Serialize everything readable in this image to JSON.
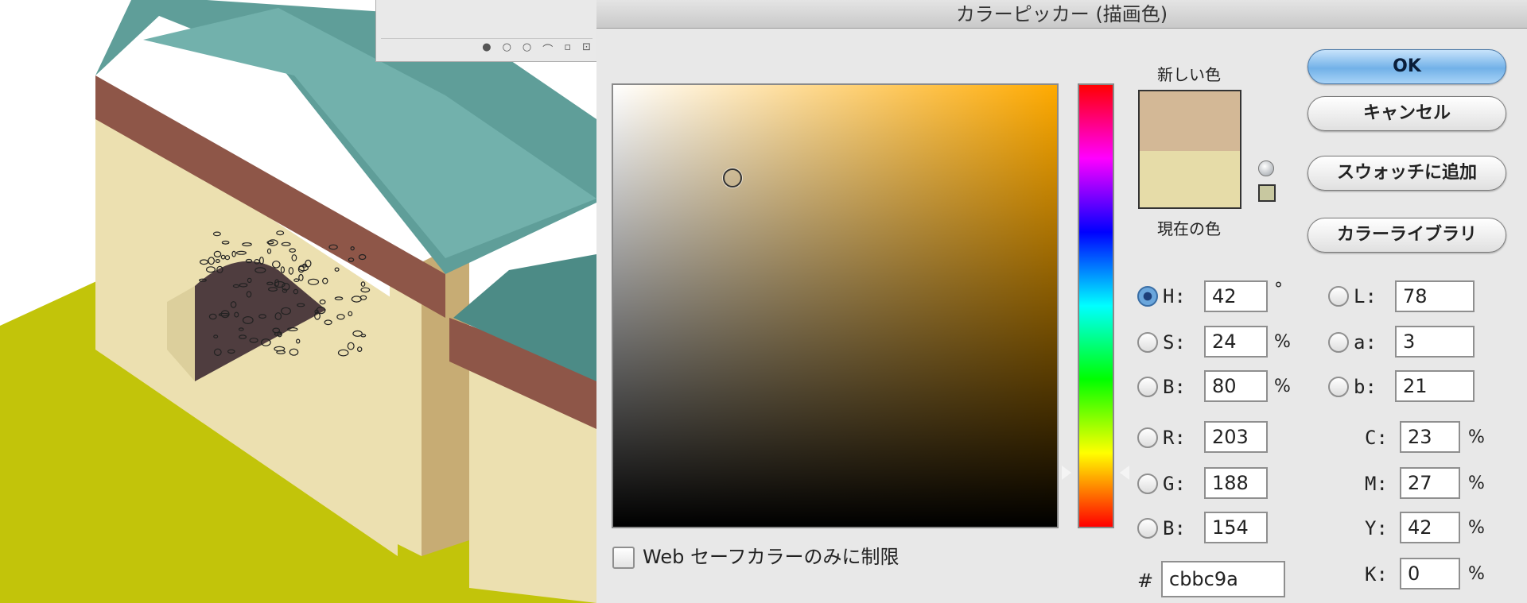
{
  "dialog": {
    "title": "カラーピッカー (描画色)",
    "new_color_label": "新しい色",
    "current_color_label": "現在の色",
    "new_color": "#d3b896",
    "current_color": "#e6dca8",
    "web_safe_color": "#c8c8a0"
  },
  "buttons": {
    "ok": "OK",
    "cancel": "キャンセル",
    "add_to_swatches": "スウォッチに追加",
    "color_libraries": "カラーライブラリ"
  },
  "fields": {
    "h": {
      "label": "H:",
      "value": "42",
      "unit": "°",
      "selected": true
    },
    "s": {
      "label": "S:",
      "value": "24",
      "unit": "%"
    },
    "b": {
      "label": "B:",
      "value": "80",
      "unit": "%"
    },
    "r": {
      "label": "R:",
      "value": "203"
    },
    "g": {
      "label": "G:",
      "value": "188"
    },
    "b_rgb": {
      "label": "B:",
      "value": "154"
    },
    "l": {
      "label": "L:",
      "value": "78"
    },
    "a": {
      "label": "a:",
      "value": "3"
    },
    "b_lab": {
      "label": "b:",
      "value": "21"
    },
    "c": {
      "label": "C:",
      "value": "23",
      "unit": "%"
    },
    "m": {
      "label": "M:",
      "value": "27",
      "unit": "%"
    },
    "y": {
      "label": "Y:",
      "value": "42",
      "unit": "%"
    },
    "k": {
      "label": "K:",
      "value": "0",
      "unit": "%"
    },
    "hex": {
      "hash": "#",
      "value": "cbbc9a"
    }
  },
  "web_safe": {
    "label": "Web セーフカラーのみに制限",
    "checked": false
  },
  "picker": {
    "hue_color": "#ffaa00"
  },
  "canvas": {
    "colors": {
      "roof": "#5f9e99",
      "roof_light": "#72b1ac",
      "roof_dark": "#4c8b86",
      "band": "#8e5648",
      "wall": "#ece0b0",
      "wall_shadow": "#dccf9c",
      "pillar": "#c7ac74",
      "arch_inside": "#4f3d3f",
      "ground": "#c2c40a",
      "selection_fill": "#d7c6a1"
    },
    "panel_icons": [
      "●",
      "○",
      "○",
      "⌒",
      "▫",
      "⊡"
    ]
  }
}
